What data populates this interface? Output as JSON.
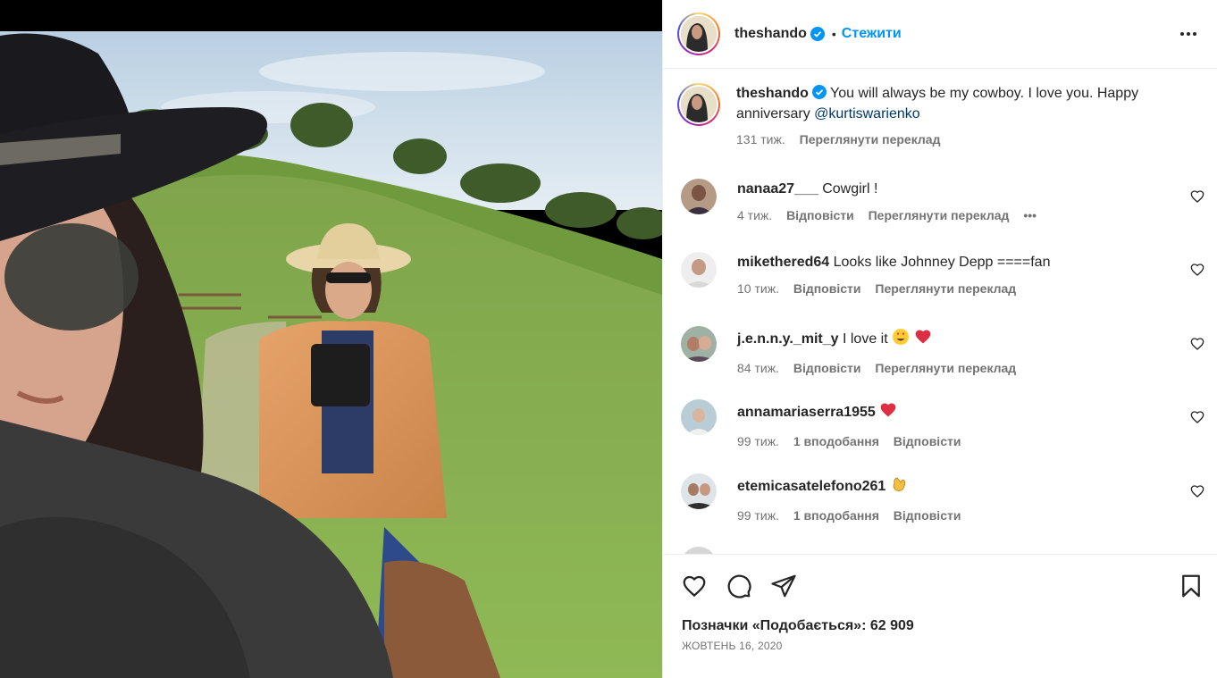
{
  "post": {
    "author": "theshando",
    "follow_label": "Стежити",
    "separator": "•"
  },
  "caption": {
    "username": "theshando",
    "text": "You will always be my cowboy. I love you. Happy anniversary ",
    "mention": "@kurtiswarienko",
    "time": "131 тиж.",
    "translate": "Переглянути переклад"
  },
  "comments": [
    {
      "username": "nanaa27___",
      "text": "Cowgirl !",
      "time": "4 тиж.",
      "reply": "Відповісти",
      "translate": "Переглянути переклад",
      "more": "•••"
    },
    {
      "username": "mikethered64",
      "text": "Looks like Johnney Depp ====fan",
      "time": "10 тиж.",
      "reply": "Відповісти",
      "translate": "Переглянути переклад"
    },
    {
      "username": "j.e.n.n.y._mit_y",
      "text": "I love it",
      "emoji": [
        "heart-eyes",
        "red-heart"
      ],
      "time": "84 тиж.",
      "reply": "Відповісти",
      "translate": "Переглянути переклад"
    },
    {
      "username": "annamariaserra1955",
      "text": "",
      "emoji": [
        "red-heart"
      ],
      "time": "99 тиж.",
      "likes": "1 вподобання",
      "reply": "Відповісти"
    },
    {
      "username": "etemicasatelefono261",
      "text": "",
      "emoji": [
        "clapping-hands"
      ],
      "time": "99 тиж.",
      "likes": "1 вподобання",
      "reply": "Відповісти"
    }
  ],
  "footer": {
    "likes_label": "Позначки «Подобається»: 62 909",
    "date": "ЖОВТЕНЬ 16, 2020"
  },
  "icons": [
    "verified-badge-icon",
    "more-options-icon",
    "heart-icon",
    "comment-icon",
    "share-icon",
    "bookmark-icon"
  ],
  "colors": {
    "accent": "#0095f6",
    "verified": "#0095f6",
    "heart_red": "#ed4956",
    "mention": "#00376b",
    "muted": "#737373"
  }
}
